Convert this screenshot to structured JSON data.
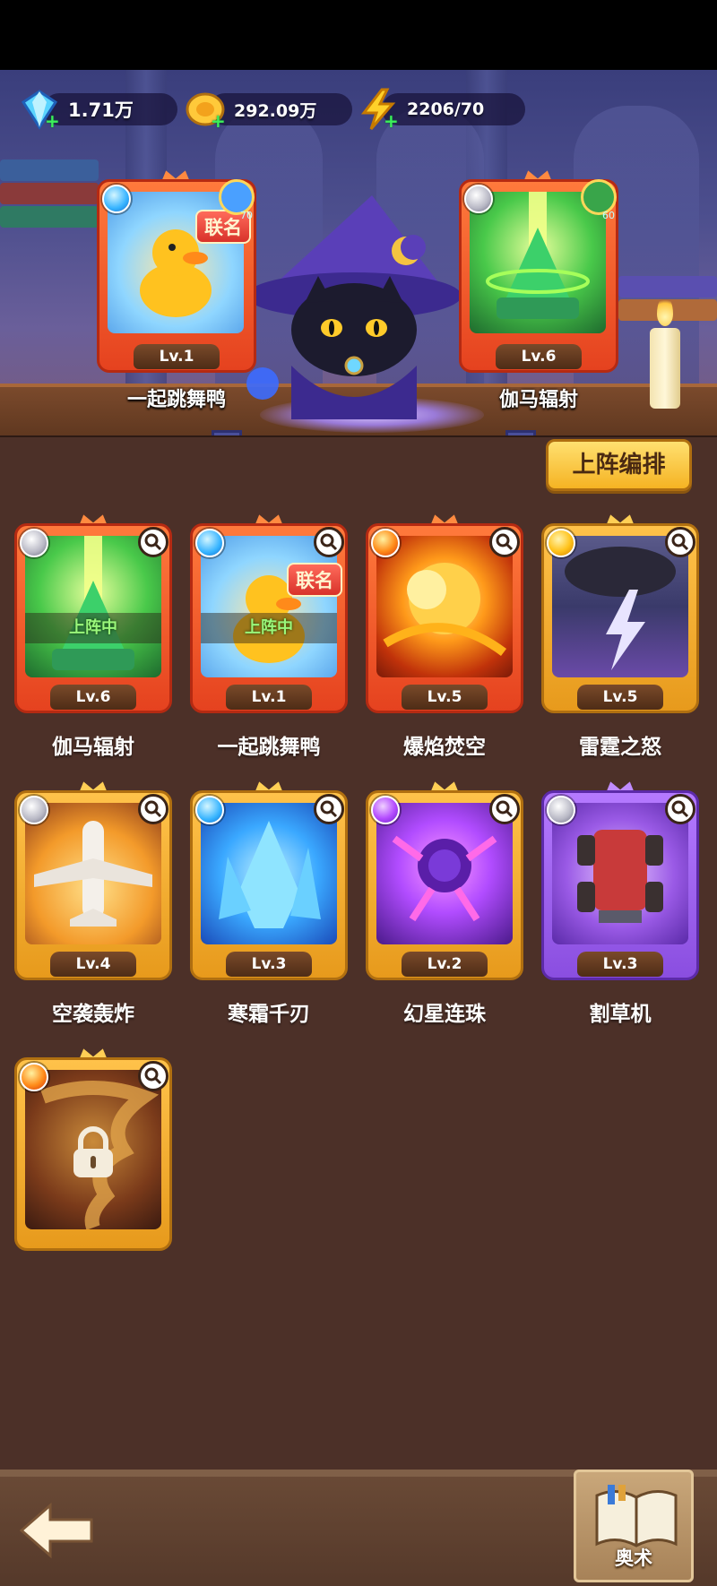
{
  "resources": [
    {
      "id": "gems",
      "value": "1.71万"
    },
    {
      "id": "coins",
      "value": "292.09万"
    },
    {
      "id": "energy",
      "value": "2206/70"
    }
  ],
  "equipped": [
    {
      "name": "一起跳舞鸭",
      "level": "Lv.1",
      "badge": "联名",
      "element": "water",
      "avatar_level": "70"
    },
    {
      "name": "伽马辐射",
      "level": "Lv.6",
      "element": "metal",
      "avatar_level": "60"
    }
  ],
  "deploy_button": "上阵编排",
  "deployed_tag": "上阵中",
  "collection_badge": "联名",
  "cards": [
    {
      "name": "伽马辐射",
      "level": "Lv.6",
      "element": "metal",
      "rarity": "red",
      "deployed": true
    },
    {
      "name": "一起跳舞鸭",
      "level": "Lv.1",
      "element": "water",
      "rarity": "red",
      "deployed": true,
      "badge": "联名"
    },
    {
      "name": "爆焰焚空",
      "level": "Lv.5",
      "element": "fire",
      "rarity": "red"
    },
    {
      "name": "雷霆之怒",
      "level": "Lv.5",
      "element": "thunder",
      "rarity": "gold"
    },
    {
      "name": "空袭轰炸",
      "level": "Lv.4",
      "element": "metal",
      "rarity": "gold"
    },
    {
      "name": "寒霜千刃",
      "level": "Lv.3",
      "element": "water",
      "rarity": "gold"
    },
    {
      "name": "幻星连珠",
      "level": "Lv.2",
      "element": "arcane",
      "rarity": "gold"
    },
    {
      "name": "割草机",
      "level": "Lv.3",
      "element": "metal",
      "rarity": "purple"
    },
    {
      "name": "",
      "level": "",
      "element": "fire",
      "rarity": "gold",
      "locked": true
    }
  ],
  "bottom": {
    "arcane_label": "奥术"
  },
  "colors": {
    "panel": "#4c3028",
    "deploy_button": "#f5b323",
    "deployed_text": "#9af77b"
  }
}
